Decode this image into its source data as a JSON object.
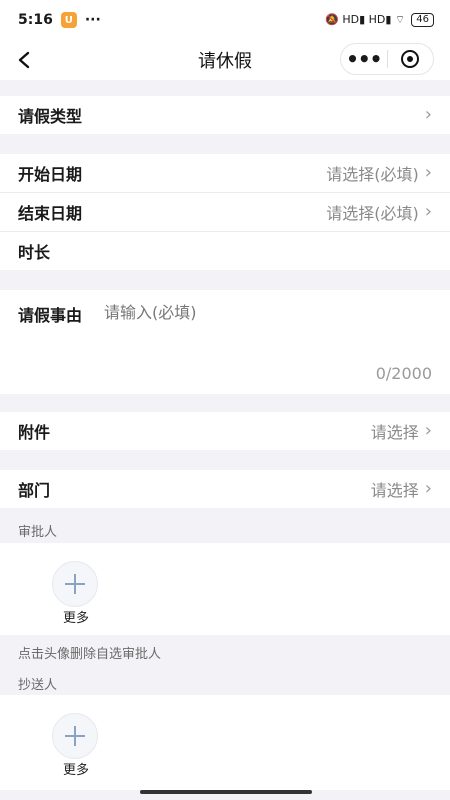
{
  "status_bar": {
    "time": "5:16",
    "app_badge": "U",
    "more": "···",
    "signal_icons": "🔕 HD▮ HD▮ ︎⌔",
    "battery": "46"
  },
  "nav": {
    "title": "请休假",
    "more_dots": "•••"
  },
  "form": {
    "leave_type": {
      "label": "请假类型"
    },
    "start_date": {
      "label": "开始日期",
      "value": "请选择(必填)"
    },
    "end_date": {
      "label": "结束日期",
      "value": "请选择(必填)"
    },
    "duration": {
      "label": "时长"
    },
    "reason": {
      "label": "请假事由",
      "placeholder": "请输入(必填)",
      "counter": "0/2000"
    },
    "attachment": {
      "label": "附件",
      "value": "请选择"
    },
    "department": {
      "label": "部门",
      "value": "请选择"
    },
    "approver": {
      "caption": "审批人",
      "more": "更多"
    },
    "approver_hint": "点击头像删除自选审批人",
    "cc": {
      "caption": "抄送人",
      "more": "更多"
    }
  },
  "chevron": "›"
}
